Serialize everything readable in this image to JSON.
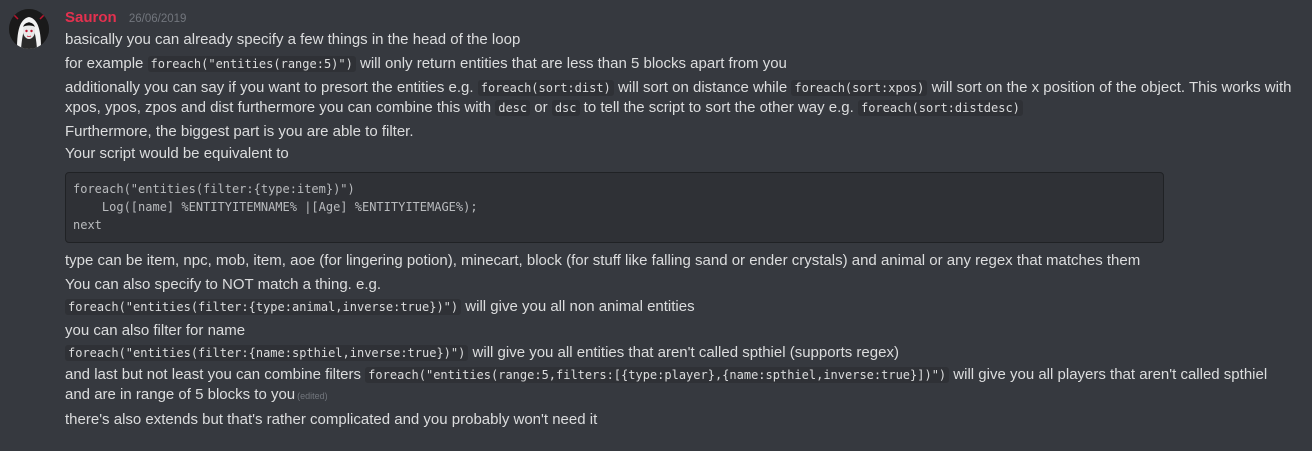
{
  "message": {
    "author": "Sauron",
    "timestamp": "26/06/2019",
    "avatar_icon": "anime-girl-avatar",
    "author_color": "#e4314f",
    "lines": {
      "l1": "basically you can already specify a few things in the head of the loop",
      "l2a": "for example ",
      "l2code": "foreach(\"entities(range:5)\")",
      "l2b": " will only return entities that are less than 5 blocks apart from you",
      "l3a": "additionally you can say if you want to presort the entities e.g. ",
      "l3code1": "foreach(sort:dist)",
      "l3b": " will sort on distance while ",
      "l3code2": "foreach(sort:xpos)",
      "l3c": " will sort on the x position of the object. This works with xpos, ypos, zpos and dist furthermore you can combine this with ",
      "l3code3": "desc",
      "l3d": " or ",
      "l3code4": "dsc",
      "l3e": " to tell the script to sort the other way e.g. ",
      "l3code5": "foreach(sort:distdesc)",
      "l4": "Furthermore, the biggest part is you are able to filter.",
      "l5": "Your script would be equivalent to",
      "codeblock": "foreach(\"entities(filter:{type:item})\")\n    Log([name] %ENTITYITEMNAME% |[Age] %ENTITYITEMAGE%);\nnext",
      "l6": "type can be item, npc, mob, item, aoe (for lingering potion), minecart, block (for stuff like falling sand or ender crystals) and animal or any regex that matches them",
      "l7": "You can also specify to NOT match a thing. e.g.",
      "l8code": "foreach(\"entities(filter:{type:animal,inverse:true})\")",
      "l8b": " will give you all non animal entities",
      "l9": "you can also filter for name",
      "l10code": "foreach(\"entities(filter:{name:spthiel,inverse:true})\")",
      "l10b": " will give you all entities that aren't called spthiel (supports regex)",
      "l11a": "and last but not least you can combine filters ",
      "l11code": "foreach(\"entities(range:5,filters:[{type:player},{name:spthiel,inverse:true}])\")",
      "l11b": " will give you all players that aren't called spthiel and are in range of 5 blocks to you",
      "edited": "(edited)",
      "l12": "there's also extends but that's rather complicated and you probably won't need it"
    }
  }
}
